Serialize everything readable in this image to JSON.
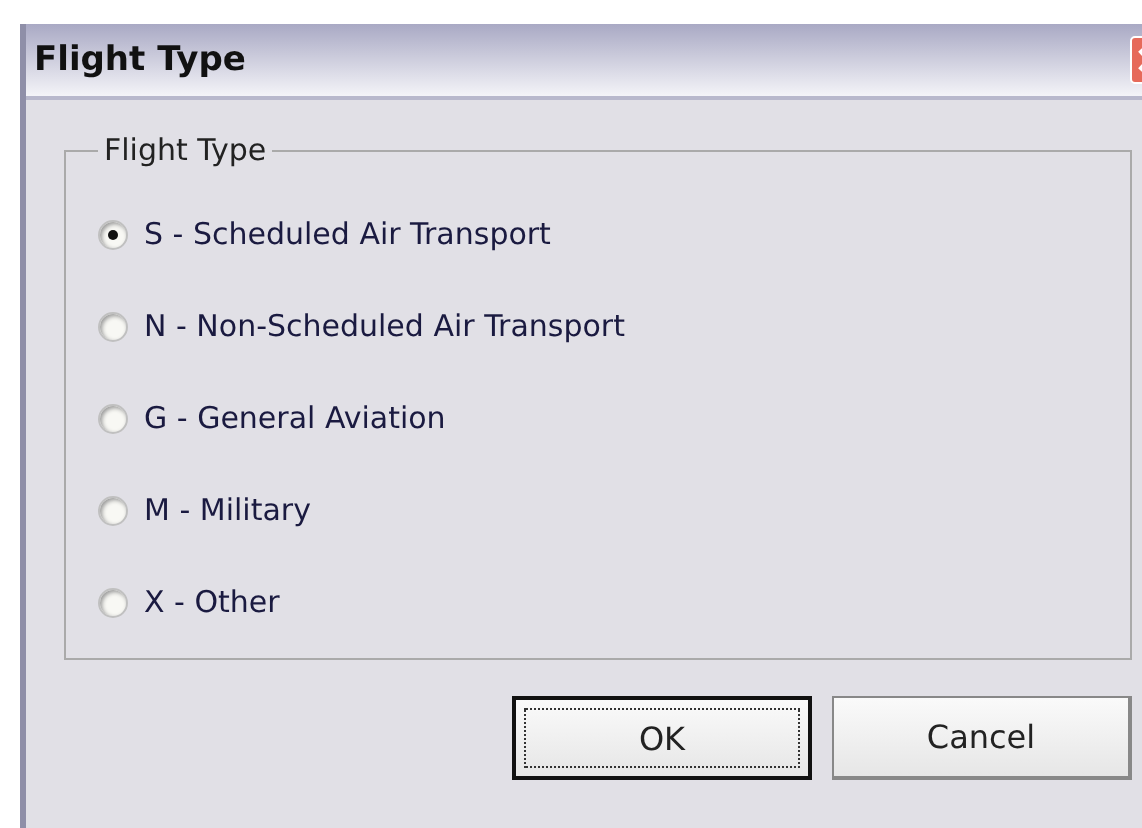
{
  "window": {
    "title": "Flight Type"
  },
  "group": {
    "title": "Flight Type",
    "options": [
      {
        "label": "S - Scheduled Air Transport",
        "selected": true
      },
      {
        "label": "N - Non-Scheduled Air Transport",
        "selected": false
      },
      {
        "label": "G - General Aviation",
        "selected": false
      },
      {
        "label": "M - Military",
        "selected": false
      },
      {
        "label": "X - Other",
        "selected": false
      }
    ]
  },
  "buttons": [
    {
      "label": "OK",
      "default": true
    },
    {
      "label": "Cancel",
      "default": false
    }
  ]
}
